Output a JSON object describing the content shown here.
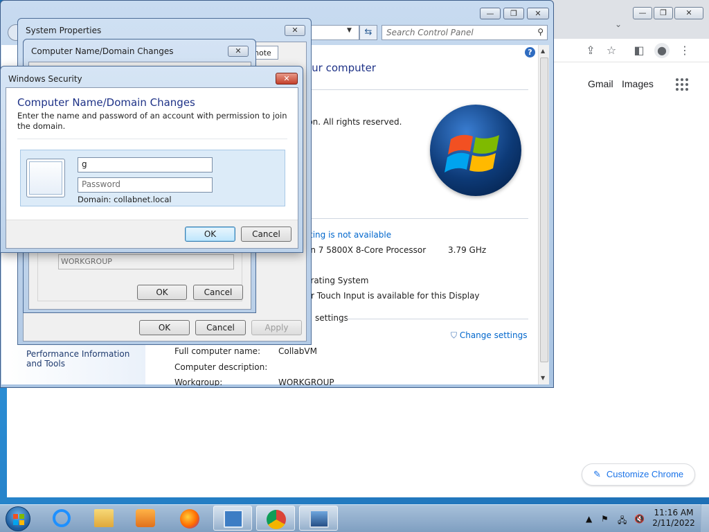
{
  "chrome": {
    "links": [
      "Gmail",
      "Images"
    ],
    "customize_label": "Customize Chrome",
    "icons": [
      "share-icon",
      "star-icon",
      "side-panel-icon",
      "profile-icon",
      "menu-icon",
      "apps-icon",
      "pencil-icon"
    ]
  },
  "control_panel": {
    "search_placeholder": "Search Control Panel",
    "heading_partial": "our computer",
    "copyright_partial": "ion.  All rights reserved.",
    "rating_link": "ting is not available",
    "processor_partial": "en 7 5800X 8-Core Processor",
    "processor_speed": "3.79 GHz",
    "os_partial": "erating System",
    "touch_partial": "r Touch Input is available for this Display",
    "settings_partial": "settings",
    "change_settings": "Change settings",
    "full_name_label": "Full computer name:",
    "full_name_value": "CollabVM",
    "description_label": "Computer description:",
    "workgroup_label": "Workgroup:",
    "workgroup_value": "WORKGROUP",
    "left_link": "Performance Information and Tools"
  },
  "system_properties": {
    "title": "System Properties",
    "tab_partial": "note",
    "ok": "OK",
    "cancel": "Cancel",
    "apply": "Apply"
  },
  "name_changes": {
    "title": "Computer Name/Domain Changes",
    "workgroup_value": "WORKGROUP",
    "ok": "OK",
    "cancel": "Cancel"
  },
  "security": {
    "title": "Windows Security",
    "heading": "Computer Name/Domain Changes",
    "instructions": "Enter the name and password of an account with permission to join the domain.",
    "username_value": "g",
    "password_placeholder": "Password",
    "domain_text": "Domain: collabnet.local",
    "ok": "OK",
    "cancel": "Cancel"
  },
  "taskbar": {
    "items": [
      "internet-explorer",
      "file-explorer",
      "media-player",
      "firefox",
      "control-panel",
      "chrome",
      "system-properties"
    ],
    "time": "11:16 AM",
    "date": "2/11/2022"
  }
}
